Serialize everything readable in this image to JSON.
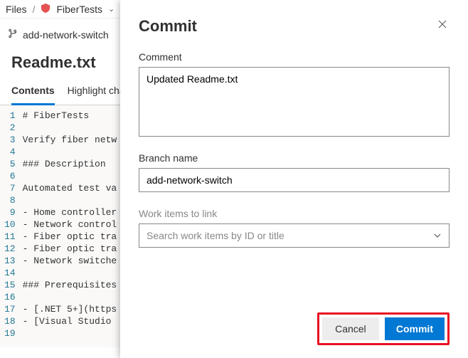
{
  "breadcrumb": {
    "files": "Files",
    "repo": "FiberTests"
  },
  "branch_bar": {
    "branch": "add-network-switch"
  },
  "file_title": "Readme.txt",
  "tabs": {
    "contents": "Contents",
    "highlight": "Highlight cha"
  },
  "code_lines": [
    "# FiberTests",
    "",
    "Verify fiber netw",
    "",
    "### Description",
    "",
    "Automated test va",
    "",
    "- Home controller",
    "- Network control",
    "- Fiber optic tra",
    "- Fiber optic tra",
    "- Network switche",
    "",
    "### Prerequisites",
    "",
    "- [.NET 5+](https",
    "- [Visual Studio ",
    ""
  ],
  "dialog": {
    "title": "Commit",
    "comment_label": "Comment",
    "comment_value": "Updated Readme.txt",
    "branch_label": "Branch name",
    "branch_value": "add-network-switch",
    "workitems_label": "Work items to link",
    "workitems_placeholder": "Search work items by ID or title",
    "cancel": "Cancel",
    "commit": "Commit"
  }
}
